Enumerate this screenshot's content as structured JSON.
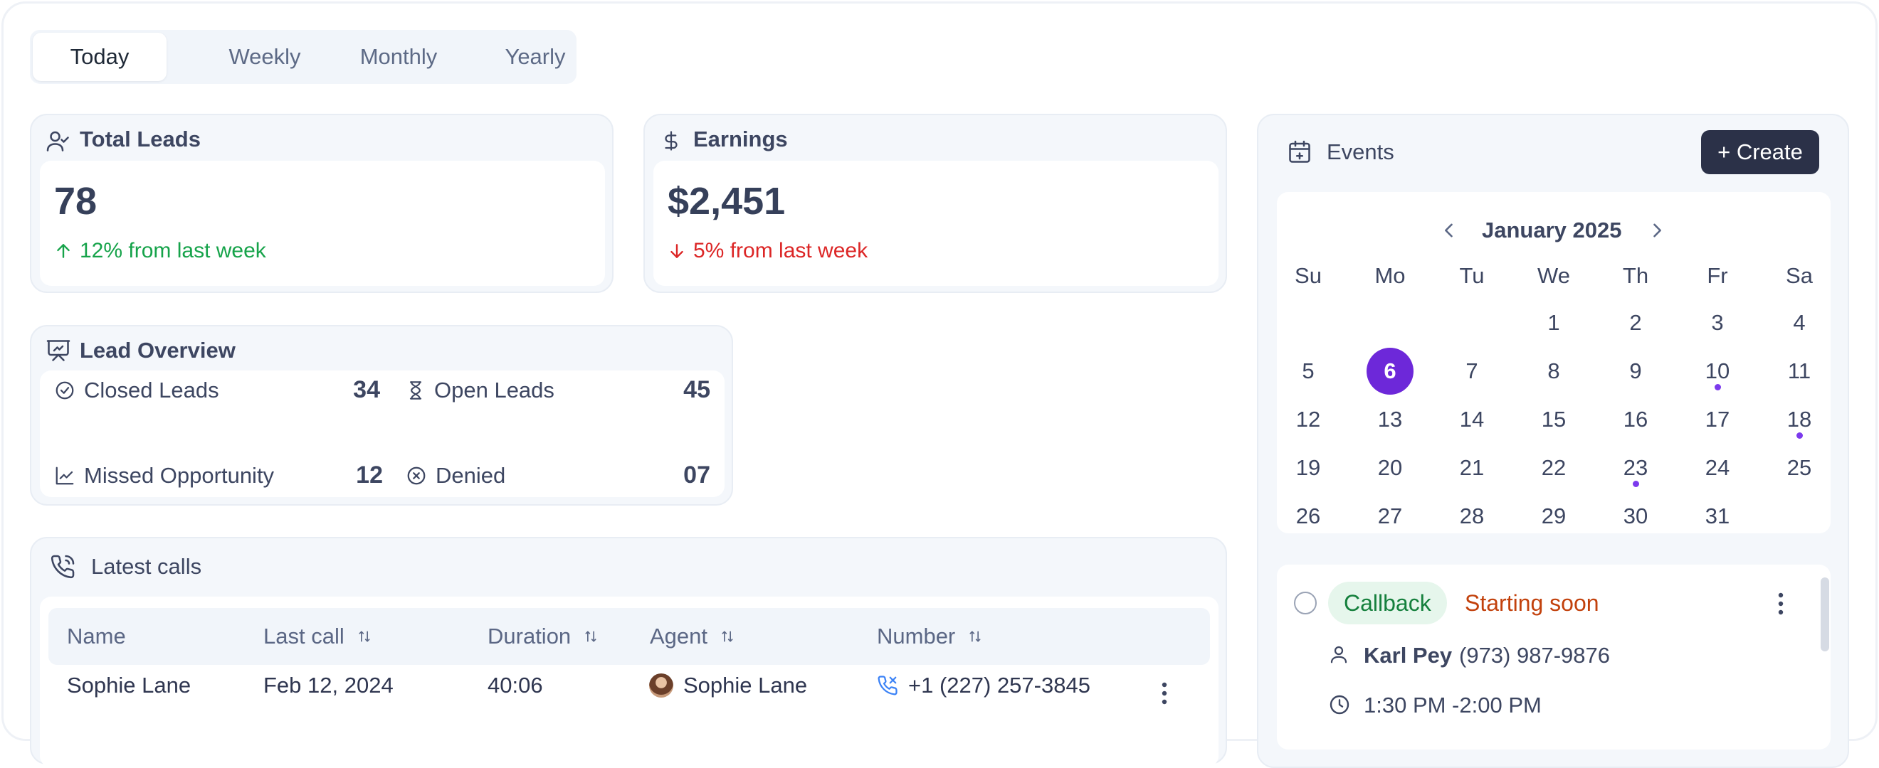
{
  "tabs": [
    {
      "label": "Today",
      "active": true
    },
    {
      "label": "Weekly",
      "active": false
    },
    {
      "label": "Monthly",
      "active": false
    },
    {
      "label": "Yearly",
      "active": false
    }
  ],
  "total_leads": {
    "title": "Total Leads",
    "value": "78",
    "delta": "12% from last week",
    "direction": "up"
  },
  "earnings": {
    "title": "Earnings",
    "value": "$2,451",
    "delta": "5% from last week",
    "direction": "down"
  },
  "lead_overview": {
    "title": "Lead Overview",
    "items": [
      {
        "label": "Closed Leads",
        "value": "34",
        "icon": "check-circle-icon"
      },
      {
        "label": "Open Leads",
        "value": "45",
        "icon": "hourglass-icon"
      },
      {
        "label": "Missed Opportunity",
        "value": "12",
        "icon": "trend-chart-icon"
      },
      {
        "label": "Denied",
        "value": "07",
        "icon": "x-circle-icon"
      }
    ]
  },
  "latest_calls": {
    "title": "Latest calls",
    "columns": [
      "Name",
      "Last call",
      "Duration",
      "Agent",
      "Number"
    ],
    "rows": [
      {
        "name": "Sophie Lane",
        "last_call": "Feb 12, 2024",
        "duration": "40:06",
        "agent": "Sophie Lane",
        "number": "+1 (227) 257-3845"
      }
    ]
  },
  "events": {
    "title": "Events",
    "create_label": "+ Create",
    "month_label": "January 2025",
    "weekdays": [
      "Su",
      "Mo",
      "Tu",
      "We",
      "Th",
      "Fr",
      "Sa"
    ],
    "selected_day": 6,
    "days_with_events": [
      10,
      18,
      23
    ],
    "event": {
      "type": "Callback",
      "status": "Starting soon",
      "contact_name": "Karl Pey",
      "contact_phone": "(973) 987-9876",
      "time": "1:30 PM -2:00 PM"
    }
  },
  "colors": {
    "accent": "#6d28d9",
    "dark_button": "#2b3148",
    "positive": "#16a34a",
    "negative": "#dc2626",
    "status_warning": "#c2410c"
  }
}
